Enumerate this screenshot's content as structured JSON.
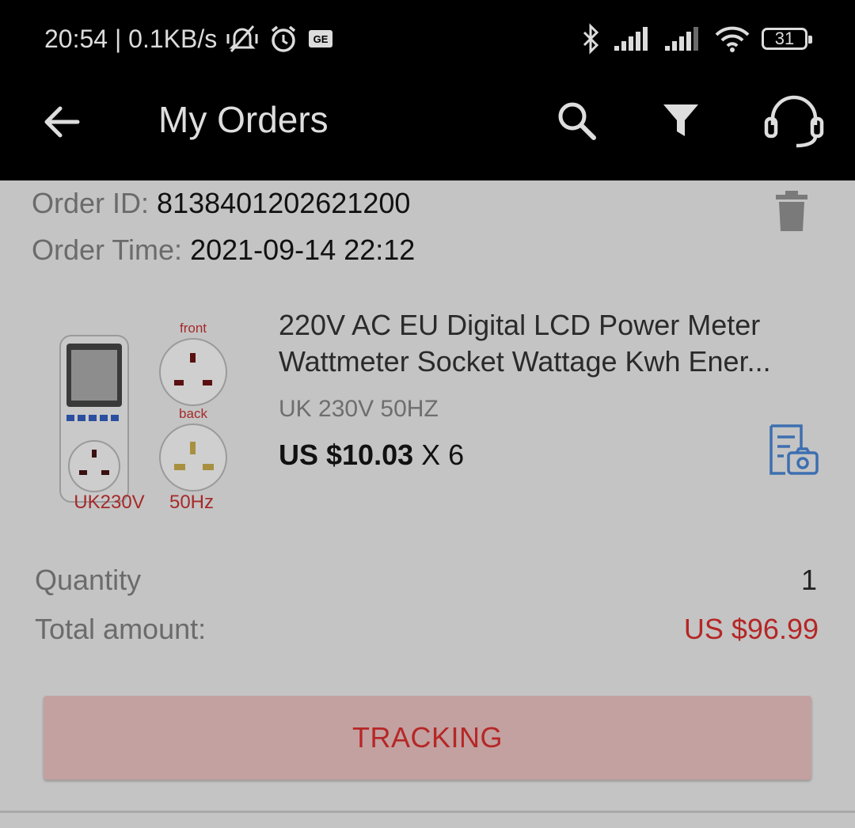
{
  "status_bar": {
    "time_speed": "20:54 | 0.1KB/s",
    "icons": [
      "vibrate-mute-icon",
      "alarm-icon",
      "gesture-badge-icon",
      "bluetooth-icon",
      "signal-icon",
      "signal-icon",
      "wifi-icon",
      "battery-icon"
    ],
    "battery": "31"
  },
  "app_bar": {
    "title": "My Orders",
    "icons": [
      "back-arrow-icon",
      "search-icon",
      "filter-icon",
      "customer-service-icon"
    ]
  },
  "order": {
    "id_label": "Order ID:",
    "id_value": "8138401202621200",
    "time_label": "Order Time:",
    "time_value": "2021-09-14 22:12",
    "product": {
      "title_line1": "220V AC EU Digital LCD Power Meter",
      "title_line2": "Wattmeter Socket Wattage Kwh Ener...",
      "variant": "UK 230V 50HZ",
      "price": "US $10.03",
      "multiplier": "X 6",
      "image_labels": {
        "front": "front",
        "back": "back",
        "voltage": "UK230V",
        "frequency": "50Hz"
      }
    },
    "quantity_label": "Quantity",
    "quantity_value": "1",
    "total_label": "Total amount:",
    "total_value": "US $96.99",
    "tracking_label": "TRACKING"
  },
  "colors": {
    "accent_red": "#b62727",
    "link_blue": "#3d6fb0",
    "scrim_background": "#c4c4c4"
  }
}
